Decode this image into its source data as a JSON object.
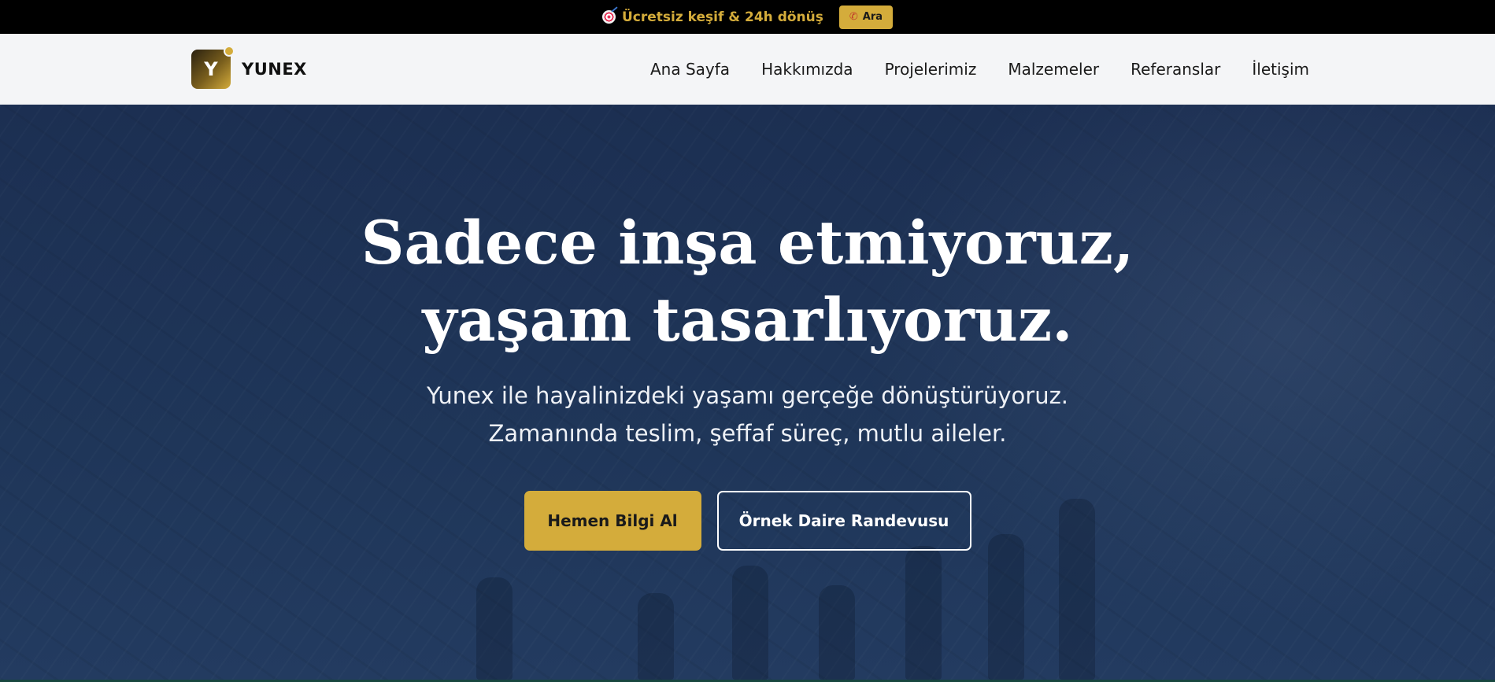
{
  "topbar": {
    "message": "Ücretsiz keşif & 24h dönüş",
    "icon": "target-icon",
    "call_label": "Ara",
    "call_icon": "phone-icon"
  },
  "header": {
    "logo_letter": "Y",
    "brand_name": "YUNEX",
    "nav": [
      {
        "label": "Ana Sayfa"
      },
      {
        "label": "Hakkımızda"
      },
      {
        "label": "Projelerimiz"
      },
      {
        "label": "Malzemeler"
      },
      {
        "label": "Referanslar"
      },
      {
        "label": "İletişim"
      }
    ]
  },
  "hero": {
    "title_line1": "Sadece inşa etmiyoruz,",
    "title_line2": "yaşam tasarlıyoruz.",
    "subtitle_line1": "Yunex ile hayalinizdeki yaşamı gerçeğe dönüştürüyoruz.",
    "subtitle_line2": "Zamanında teslim, şeffaf süreç, mutlu aileler.",
    "primary_cta": "Hemen Bilgi Al",
    "secondary_cta": "Örnek Daire Randevusu"
  },
  "colors": {
    "accent": "#d4ac3b",
    "hero_bg": "#1d3256",
    "header_bg": "#f4f5f7",
    "topbar_bg": "#000000"
  }
}
